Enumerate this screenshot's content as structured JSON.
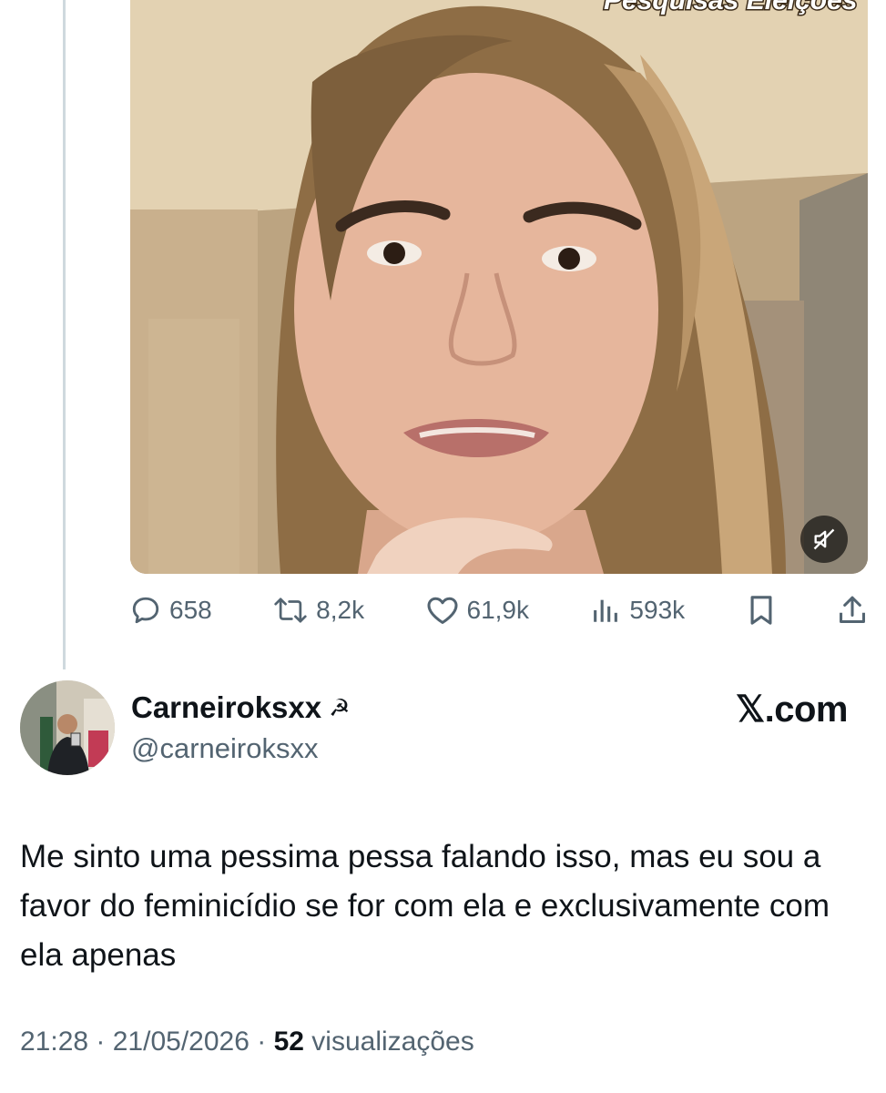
{
  "previous_tweet": {
    "video_overlay_text": "Pesquisas Eleições",
    "actions": {
      "replies": "658",
      "retweets": "8,2k",
      "likes": "61,9k",
      "views": "593k"
    }
  },
  "tweet": {
    "display_name": "Carneiroksxx",
    "name_emoji": "☭",
    "handle": "@carneiroksxx",
    "site_label": "𝕏.com",
    "text": "Me sinto uma pessima pessa falando isso, mas eu sou a favor do feminicídio se for com ela e exclusivamente com ela apenas",
    "time": "21:28",
    "separator": " · ",
    "date": "21/05/2026",
    "views_count": "52",
    "views_label": " visualizações"
  },
  "colors": {
    "text_primary": "#0f1419",
    "text_secondary": "#536471",
    "thread_line": "#cfd9de"
  }
}
